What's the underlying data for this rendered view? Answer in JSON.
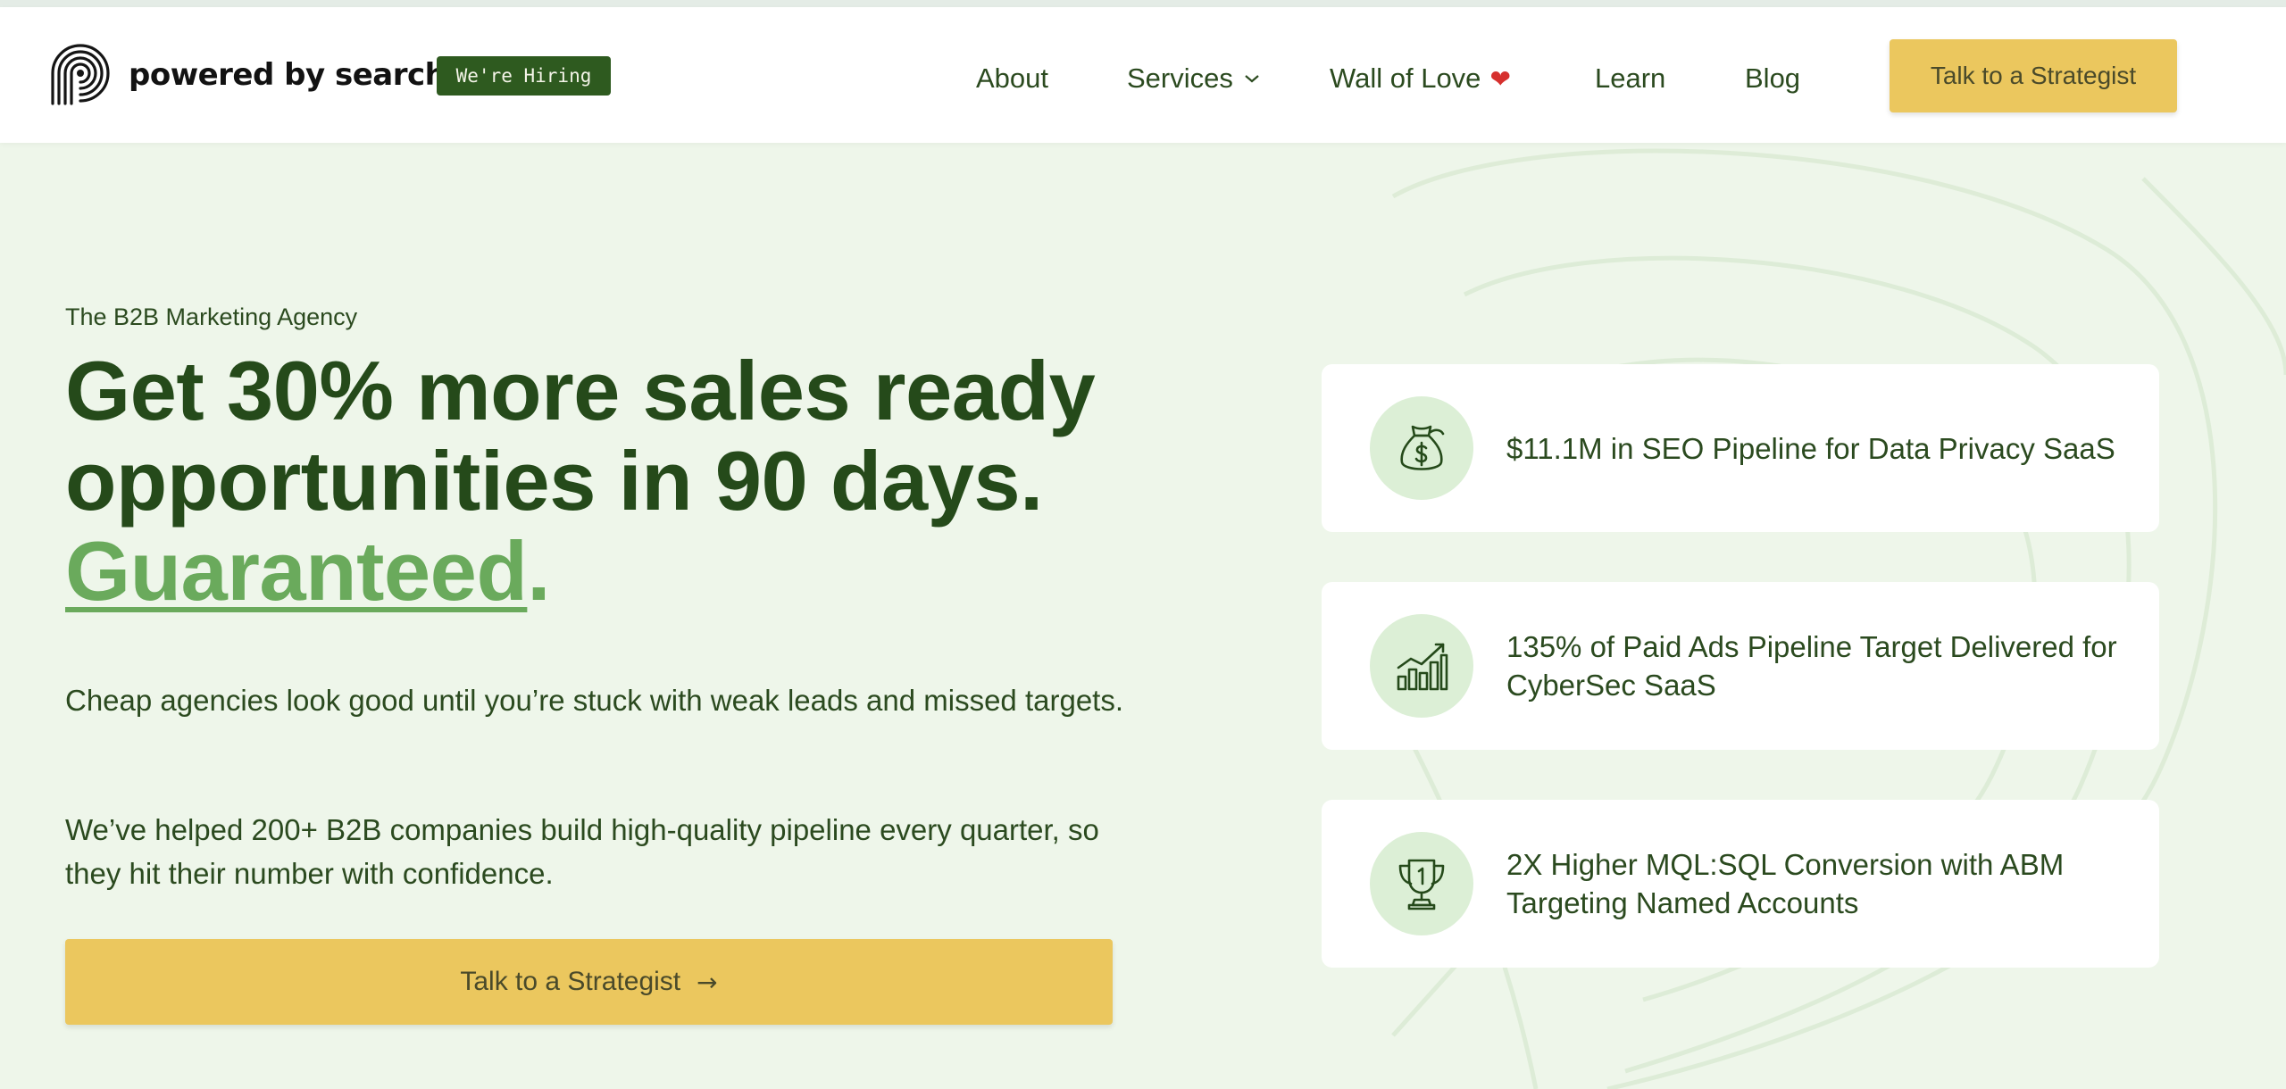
{
  "header": {
    "brand": "powered by search",
    "hiring_badge": "We're Hiring",
    "nav": [
      {
        "label": "About"
      },
      {
        "label": "Services"
      },
      {
        "label": "Wall of Love"
      },
      {
        "label": "Learn"
      },
      {
        "label": "Blog"
      }
    ],
    "heart": "❤",
    "cta": "Talk to a Strategist"
  },
  "hero": {
    "eyebrow": "The B2B Marketing Agency",
    "headline_line1": "Get 30% more sales ready",
    "headline_line2": "opportunities in 90 days.",
    "headline_highlight": "Guaranteed",
    "headline_period": ".",
    "paragraph1": "Cheap agencies look good until you’re stuck with weak leads and missed targets.",
    "paragraph2": "We’ve helped 200+ B2B companies build high-quality pipeline every quarter, so they hit their number with confidence.",
    "cta": "Talk to a Strategist",
    "cta_arrow": "→"
  },
  "cards": [
    {
      "icon": "money-bag-icon",
      "text": "$11.1M in SEO Pipeline for Data Privacy SaaS"
    },
    {
      "icon": "bar-chart-growth-icon",
      "text": "135% of Paid Ads Pipeline Target Delivered for CyberSec SaaS"
    },
    {
      "icon": "trophy-icon",
      "text": "2X Higher MQL:SQL Conversion with ABM Targeting Named Accounts"
    }
  ],
  "colors": {
    "brand_dark_green": "#254a1a",
    "accent_green": "#6aaa5c",
    "cta_yellow": "#ebc75e",
    "background": "#eef6ea",
    "icon_circle": "#dcefd6"
  }
}
